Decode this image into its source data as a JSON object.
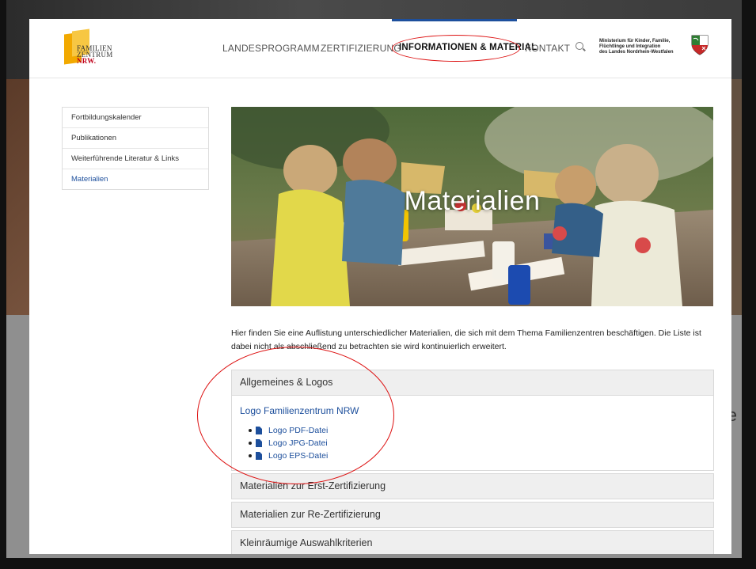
{
  "header": {
    "logo": {
      "line1": "FAMILIEN",
      "line2": "ZENTRUM",
      "line3": "NRW."
    },
    "nav": [
      "LANDESPROGRAMM",
      "ZERTIFIZIERUNG",
      "INFORMATIONEN & MATERIAL",
      "KONTAKT"
    ],
    "active_nav": "INFORMATIONEN & MATERIAL",
    "ministry_lines": [
      "Ministerium für Kinder, Familie,",
      "Flüchtlinge und Integration",
      "des Landes Nordrhein-Westfalen"
    ]
  },
  "sidebar": {
    "items": [
      "Fortbildungskalender",
      "Publikationen",
      "Weiterführende Literatur & Links",
      "Materialien"
    ],
    "active": "Materialien"
  },
  "hero": {
    "title": "Materialien"
  },
  "intro": "Hier finden Sie eine Auflistung unterschiedlicher Materialien, die sich mit dem Thema Familienzentren beschäftigen. Die Liste ist dabei nicht als abschließend zu betrachten sie wird kontinuierlich erweitert.",
  "accordion": [
    {
      "title": "Allgemeines & Logos",
      "expanded": true,
      "heading": "Logo Familienzentrum NRW",
      "links": [
        "Logo PDF-Datei",
        "Logo JPG-Datei",
        "Logo EPS-Datei"
      ]
    },
    {
      "title": "Materialien zur Erst-Zertifizierung",
      "expanded": false
    },
    {
      "title": "Materialien zur Re-Zertifizierung",
      "expanded": false
    },
    {
      "title": "Kleinräumige Auswahlkriterien",
      "expanded": false
    }
  ],
  "background_glyph": "e",
  "colors": {
    "accent": "#1d4f9c",
    "annotation": "#dd1111",
    "logo_yellow": "#f2a900",
    "logo_red": "#c0001a"
  }
}
